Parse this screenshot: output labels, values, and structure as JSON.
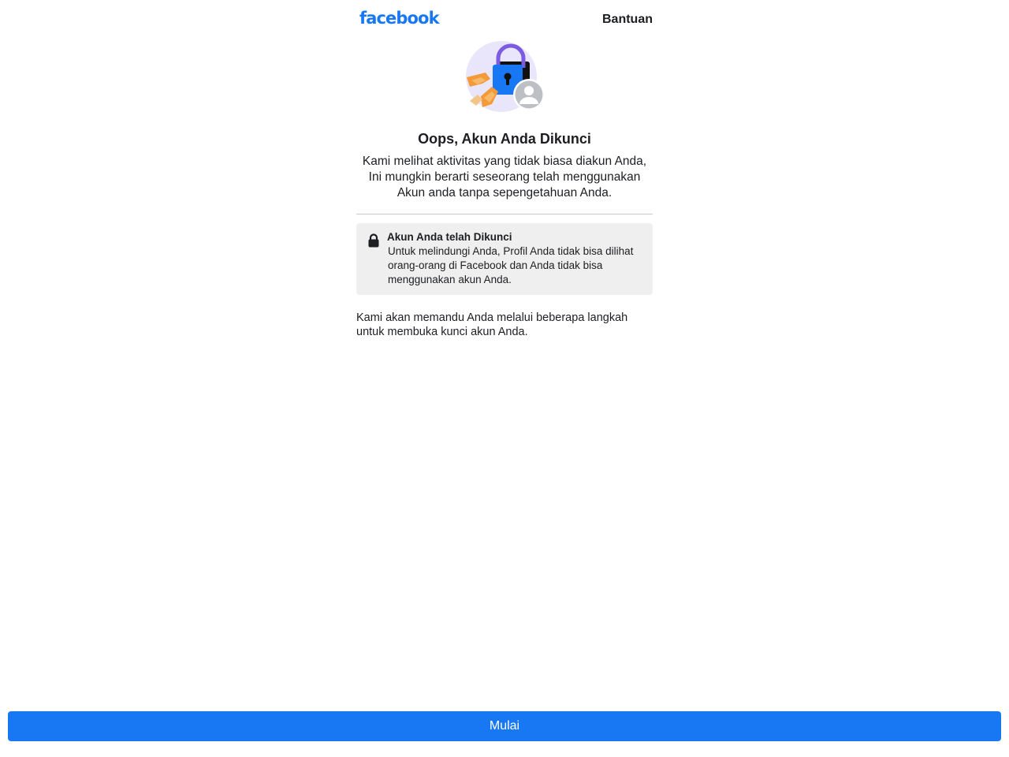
{
  "header": {
    "logo_text": "facebook",
    "help_label": "Bantuan"
  },
  "main": {
    "illustration_icon": "locked-account-illustration",
    "title": "Oops, Akun Anda Dikunci",
    "subtitle": "Kami melihat aktivitas yang tidak biasa diakun Anda, Ini mungkin berarti seseorang telah menggunakan Akun anda tanpa sepengetahuan Anda.",
    "notice": {
      "icon": "lock-icon",
      "title": "Akun Anda telah Dikunci",
      "body": "Untuk melindungi Anda, Profil Anda tidak bisa dilihat orang-orang di Facebook dan Anda tidak bisa menggunakan akun Anda."
    },
    "guide_text": "Kami akan memandu Anda melalui beberapa langkah untuk membuka kunci akun Anda."
  },
  "footer": {
    "start_button_label": "Mulai"
  },
  "colors": {
    "brand_blue": "#1877f2",
    "notice_bg": "#efefef",
    "text": "#1c1e21"
  }
}
